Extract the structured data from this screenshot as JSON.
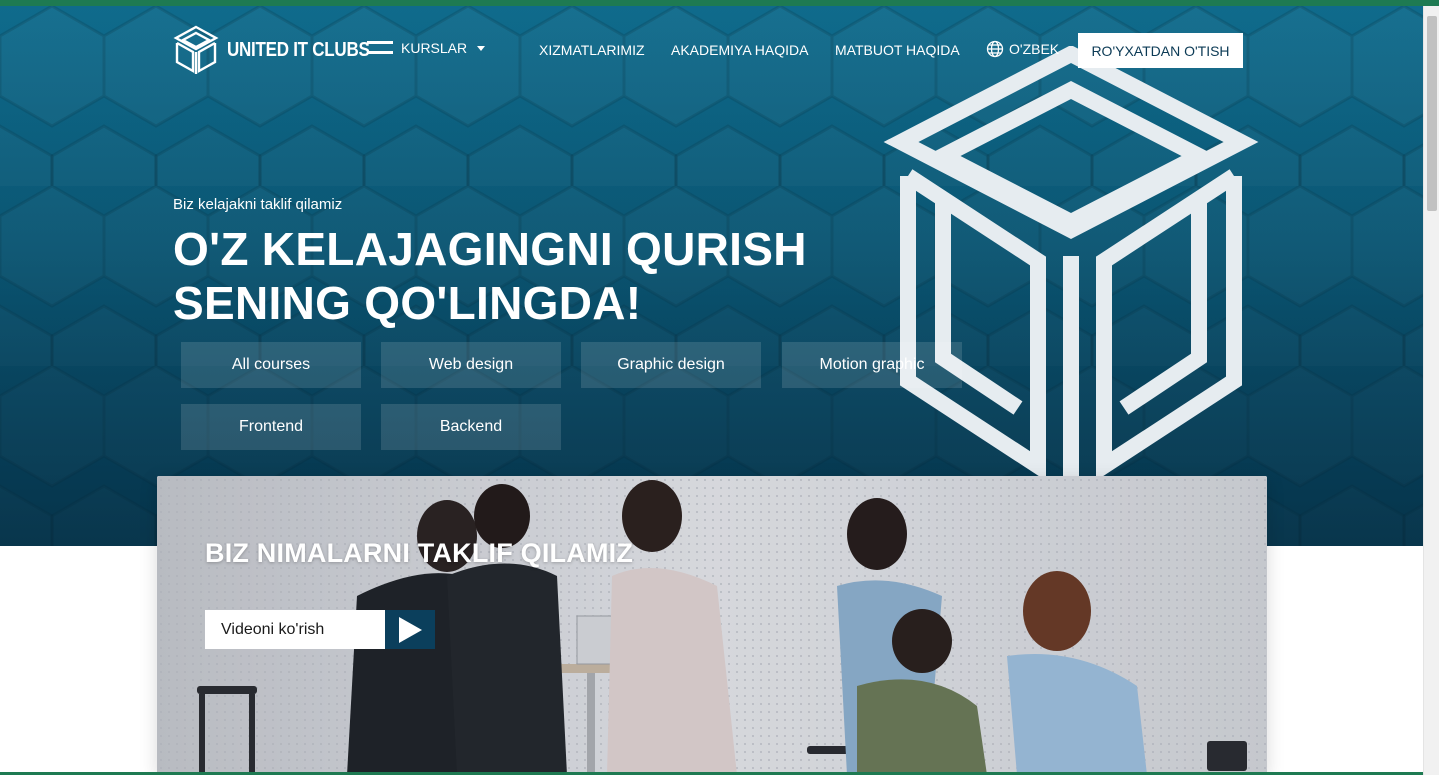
{
  "header": {
    "logo_text": "UNITED IT CLUBS",
    "courses_label": "KURSLAR",
    "nav": [
      {
        "label": "XIZMATLARIMIZ"
      },
      {
        "label": "AKADEMIYA HAQIDA"
      },
      {
        "label": "MATBUOT HAQIDA"
      }
    ],
    "language": "O'ZBEK",
    "register_label": "RO'YXATDAN O'TISH"
  },
  "hero": {
    "tagline": "Biz kelajakni taklif qilamiz",
    "headline_line1": "O'Z KELAJAGINGNI QURISH",
    "headline_line2": "SENING QO'LINGDA!",
    "categories": [
      "All courses",
      "Web design",
      "Graphic design",
      "Motion graphic",
      "Frontend",
      "Backend"
    ]
  },
  "offer": {
    "title": "BIZ NIMALARNI TAKLIF QILAMIZ",
    "video_label": "Videoni ko'rish"
  },
  "colors": {
    "accent_green": "#1e7a52",
    "hero_blue": "#0b5a78",
    "play_blue": "#0b3f5c"
  }
}
